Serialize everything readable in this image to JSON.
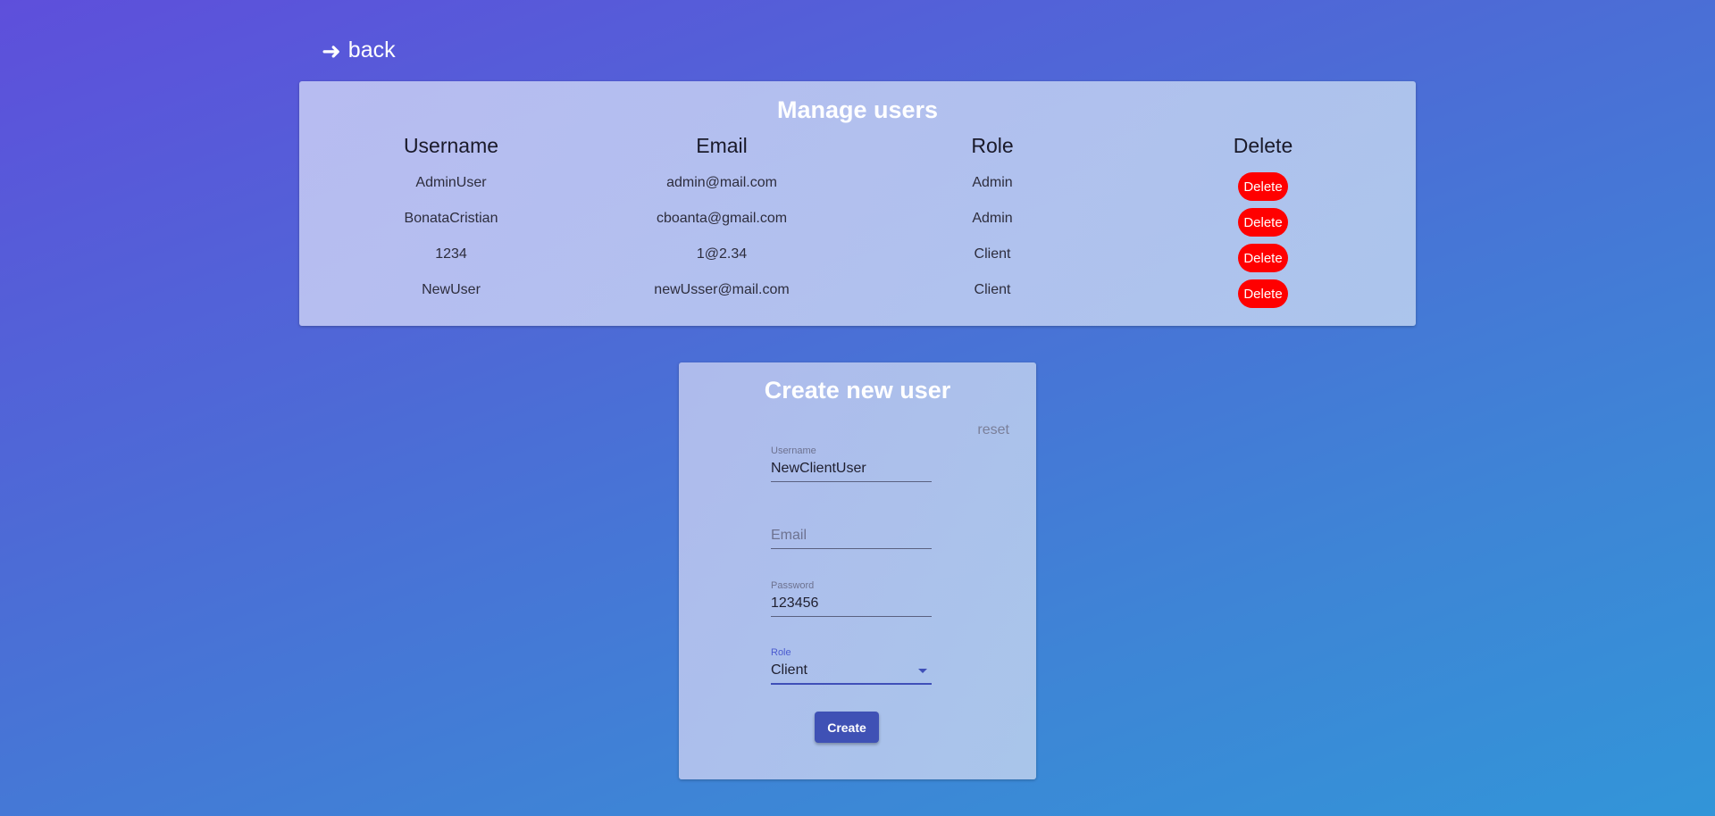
{
  "nav": {
    "back_arrow": "➜",
    "back_label": "back"
  },
  "manage_users": {
    "title": "Manage users",
    "headers": [
      "Username",
      "Email",
      "Role",
      "Delete"
    ],
    "rows": [
      {
        "username": "AdminUser",
        "email": "admin@mail.com",
        "role": "Admin",
        "action": "Delete"
      },
      {
        "username": "BonataCristian",
        "email": "cboanta@gmail.com",
        "role": "Admin",
        "action": "Delete"
      },
      {
        "username": "1234",
        "email": "1@2.34",
        "role": "Client",
        "action": "Delete"
      },
      {
        "username": "NewUser",
        "email": "newUsser@mail.com",
        "role": "Client",
        "action": "Delete"
      }
    ]
  },
  "create_user": {
    "title": "Create new user",
    "reset_label": "reset",
    "username": {
      "label": "Username",
      "value": "NewClientUser"
    },
    "email": {
      "label": "",
      "value": "",
      "placeholder": "Email"
    },
    "password": {
      "label": "Password",
      "value": "123456"
    },
    "role": {
      "label": "Role",
      "value": "Client"
    },
    "submit_label": "Create"
  },
  "colors": {
    "delete_button": "#ff0000",
    "primary_button": "#3f51b5"
  }
}
